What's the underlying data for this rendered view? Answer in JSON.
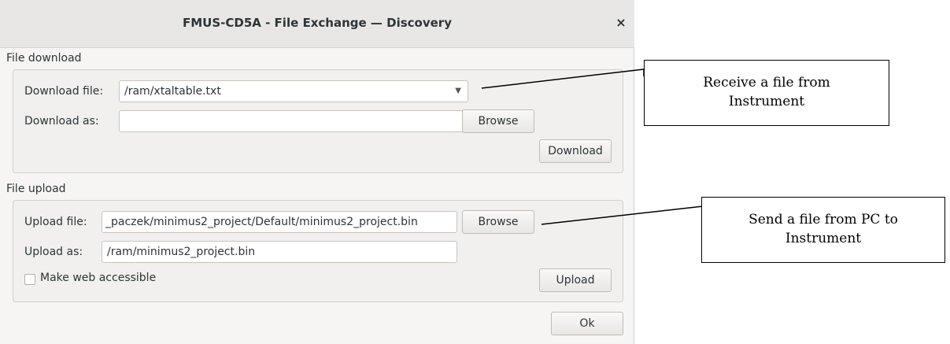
{
  "window": {
    "title": "FMUS-CD5A - File Exchange — Discovery",
    "close_glyph": "×"
  },
  "download": {
    "section_label": "File download",
    "file_label": "Download file:",
    "file_value": "/ram/xtaltable.txt",
    "as_label": "Download as:",
    "as_value": "",
    "browse_label": "Browse",
    "action_label": "Download"
  },
  "upload": {
    "section_label": "File upload",
    "file_label": "Upload file:",
    "file_value": "_paczek/minimus2_project/Default/minimus2_project.bin",
    "as_label": "Upload as:",
    "as_value": "/ram/minimus2_project.bin",
    "browse_label": "Browse",
    "web_label": "Make web accessible",
    "web_checked": false,
    "action_label": "Upload"
  },
  "ok_label": "Ok",
  "callouts": {
    "receive": [
      "Receive a file from",
      "Instrument"
    ],
    "send": [
      "Send a file from PC to",
      "Instrument"
    ]
  },
  "icons": {
    "combo_arrow": "chevron-down-icon",
    "close": "close-icon"
  }
}
